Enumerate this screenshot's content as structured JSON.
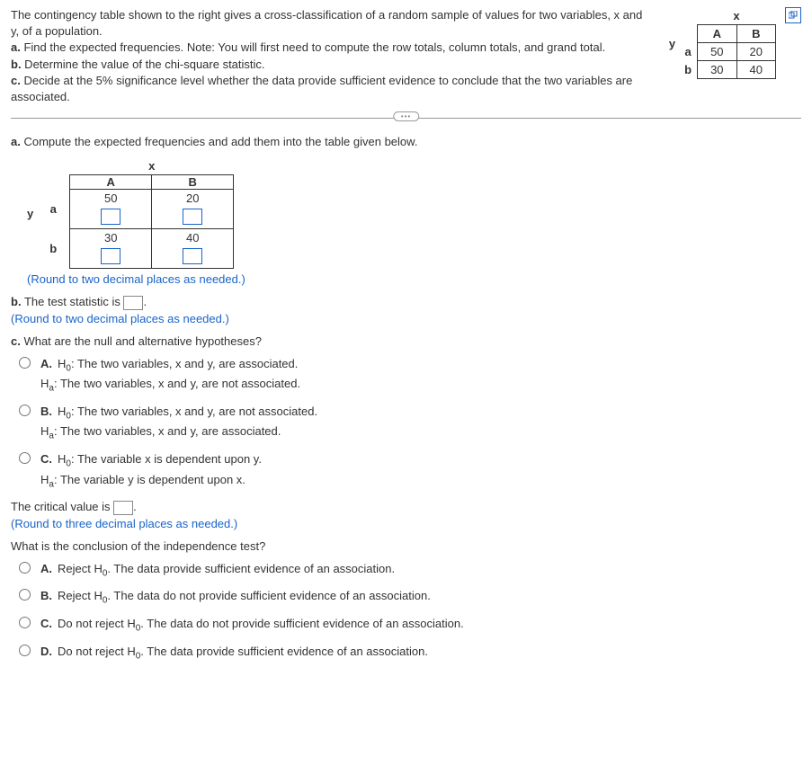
{
  "prompt": {
    "line1": "The contingency table shown to the right gives a cross-classification of a random sample of values for two variables, x and y, of a population.",
    "line_a": "a.",
    "line_a_text": " Find the expected frequencies. Note: You will first need to compute the row totals, column totals, and grand total.",
    "line_b": "b.",
    "line_b_text": " Determine the value of the chi-square statistic.",
    "line_c": "c.",
    "line_c_text": " Decide at the 5% significance level whether the data provide sufficient evidence to conclude that the two variables are associated."
  },
  "contingency": {
    "x_label": "x",
    "y_label": "y",
    "col_a": "A",
    "col_b": "B",
    "row_a": "a",
    "row_b": "b",
    "vals": {
      "aa": "50",
      "ab": "20",
      "ba": "30",
      "bb": "40"
    }
  },
  "part_a": {
    "prompt": "a. Compute the expected frequencies and add them into the table given below.",
    "x_label": "x",
    "y_label": "y",
    "col_a": "A",
    "col_b": "B",
    "row_a": "a",
    "row_b": "b",
    "vals": {
      "aa": "50",
      "ab": "20",
      "ba": "30",
      "bb": "40"
    },
    "hint": "(Round to two decimal places as needed.)"
  },
  "part_b": {
    "prefix": "b. The test statistic is ",
    "suffix": ".",
    "hint": "(Round to two decimal places as needed.)"
  },
  "part_c": {
    "prompt": "c. What are the null and alternative hypotheses?",
    "options": [
      {
        "label": "A.",
        "h0": "The two variables, x and y, are associated.",
        "ha": "The two variables, x and y, are not associated."
      },
      {
        "label": "B.",
        "h0": "The two variables, x and y, are not associated.",
        "ha": "The two variables, x and y, are associated."
      },
      {
        "label": "C.",
        "h0": "The variable x is dependent upon y.",
        "ha": "The variable y is dependent upon x."
      }
    ]
  },
  "critical": {
    "prefix": "The critical value is ",
    "suffix": ".",
    "hint": "(Round to three decimal places as needed.)"
  },
  "conclusion": {
    "prompt": "What is the conclusion of the independence test?",
    "options": [
      {
        "label": "A.",
        "text": "Reject H₀. The data provide sufficient evidence of an association."
      },
      {
        "label": "B.",
        "text": "Reject H₀. The data do not provide sufficient evidence of an association."
      },
      {
        "label": "C.",
        "text": "Do not reject H₀. The data do not provide sufficient evidence of an association."
      },
      {
        "label": "D.",
        "text": "Do not reject H₀. The data provide sufficient evidence of an association."
      }
    ]
  },
  "h0_prefix": "H₀: ",
  "ha_prefix": "Hₐ: "
}
